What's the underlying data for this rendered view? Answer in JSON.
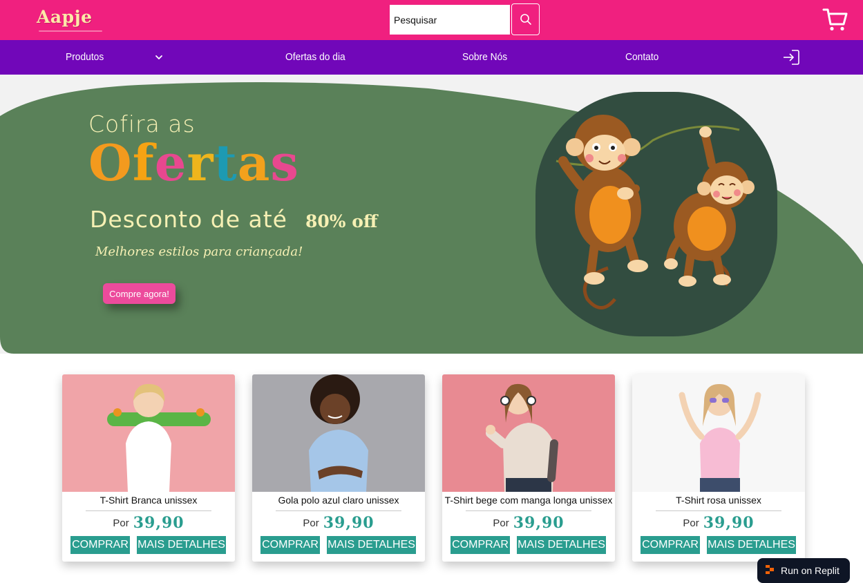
{
  "header": {
    "logo_text": "Aapje",
    "search_placeholder": "Pesquisar",
    "search_value": "",
    "brand_color": "#f0207f",
    "icons": [
      "search-icon",
      "cart-icon"
    ]
  },
  "nav": {
    "items": [
      {
        "label": "Produtos"
      },
      {
        "label": "Ofertas do dia"
      },
      {
        "label": "Sobre Nós"
      },
      {
        "label": "Contato"
      }
    ],
    "icons": [
      "chevron-down-icon",
      "login-icon"
    ],
    "bg_color": "#7107b9"
  },
  "hero": {
    "line1": "Cofira as",
    "headline_letters": [
      "O",
      "f",
      "e",
      "r",
      "t",
      "a",
      "s"
    ],
    "line3": "Desconto de até",
    "discount": "80% off",
    "tagline": "Melhores estilos para criançada!",
    "cta_label": "Compre agora!",
    "bg_color": "#5a8159"
  },
  "products": [
    {
      "name": "T-Shirt Branca unissex",
      "price_label": "Por",
      "price": "39,90",
      "buy_label": "COMPRAR",
      "details_label": "MAIS DETALHES"
    },
    {
      "name": "Gola polo azul claro unissex",
      "price_label": "Por",
      "price": "39,90",
      "buy_label": "COMPRAR",
      "details_label": "MAIS DETALHES"
    },
    {
      "name": "T-Shirt bege com manga longa unissex",
      "price_label": "Por",
      "price": "39,90",
      "buy_label": "COMPRAR",
      "details_label": "MAIS DETALHES"
    },
    {
      "name": "T-Shirt rosa unissex",
      "price_label": "Por",
      "price": "39,90",
      "buy_label": "COMPRAR",
      "details_label": "MAIS DETALHES"
    }
  ],
  "accent_color": "#2a9d8f",
  "replit_badge": {
    "label": "Run on Replit"
  }
}
